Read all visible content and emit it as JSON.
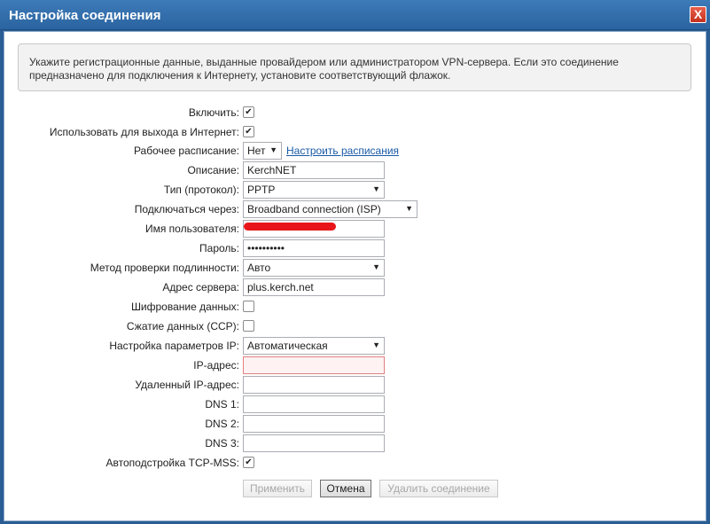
{
  "dialog": {
    "title": "Настройка соединения",
    "close_label": "X"
  },
  "info_text": "Укажите регистрационные данные, выданные провайдером или администратором VPN-сервера. Если это соединение предназначено для подключения к Интернету, установите соответствующий флажок.",
  "form": {
    "enable": {
      "label": "Включить:",
      "checked": true
    },
    "internet": {
      "label": "Использовать для выхода в Интернет:",
      "checked": true
    },
    "schedule": {
      "label": "Рабочее расписание:",
      "value": "Нет",
      "link": "Настроить расписания"
    },
    "description": {
      "label": "Описание:",
      "value": "KerchNET"
    },
    "protocol": {
      "label": "Тип (протокол):",
      "value": "PPTP"
    },
    "via": {
      "label": "Подключаться через:",
      "value": "Broadband connection (ISP)"
    },
    "username": {
      "label": "Имя пользователя:",
      "value": ""
    },
    "password": {
      "label": "Пароль:",
      "value": "••••••••••"
    },
    "auth": {
      "label": "Метод проверки подлинности:",
      "value": "Авто"
    },
    "server": {
      "label": "Адрес сервера:",
      "value": "plus.kerch.net"
    },
    "encryption": {
      "label": "Шифрование данных:",
      "checked": false
    },
    "compression": {
      "label": "Сжатие данных (CCP):",
      "checked": false
    },
    "ip_settings": {
      "label": "Настройка параметров IP:",
      "value": "Автоматическая"
    },
    "ip_address": {
      "label": "IP-адрес:",
      "value": ""
    },
    "remote_ip": {
      "label": "Удаленный IP-адрес:",
      "value": ""
    },
    "dns1": {
      "label": "DNS 1:",
      "value": ""
    },
    "dns2": {
      "label": "DNS 2:",
      "value": ""
    },
    "dns3": {
      "label": "DNS 3:",
      "value": ""
    },
    "tcp_mss": {
      "label": "Автоподстройка TCP-MSS:",
      "checked": true
    }
  },
  "buttons": {
    "apply": "Применить",
    "cancel": "Отмена",
    "delete": "Удалить соединение"
  },
  "colors": {
    "title_bar": "#2b64a0",
    "close_button": "#c4301e",
    "link": "#1a5aa6",
    "error_border": "#e08080"
  },
  "icons": {
    "close": "close-icon",
    "dropdown": "chevron-down-icon",
    "checkbox": "checkmark-icon"
  }
}
